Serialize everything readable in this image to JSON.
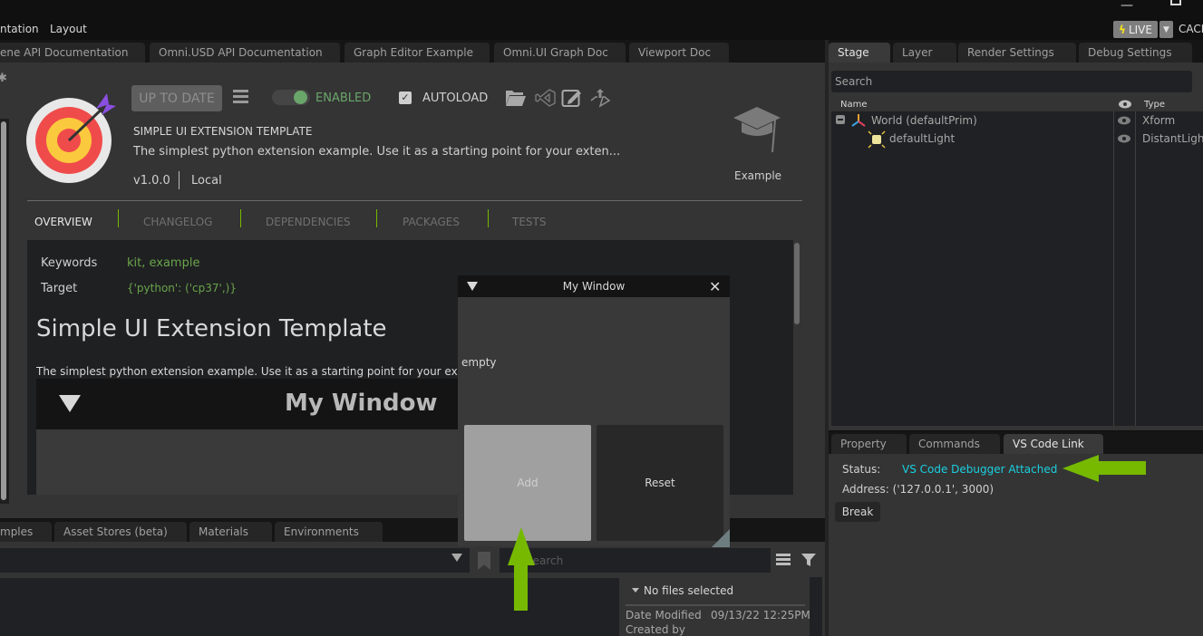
{
  "menubar": {
    "items": [
      "ntation",
      "Layout"
    ],
    "live_label": "LIVE",
    "cache_label": "CACH"
  },
  "doc_tabs": [
    {
      "label": "ene API Documentation"
    },
    {
      "label": "Omni.USD API Documentation"
    },
    {
      "label": "Graph Editor Example"
    },
    {
      "label": "Omni.UI Graph Doc"
    },
    {
      "label": "Viewport Doc"
    }
  ],
  "extension": {
    "status_button": "UP TO DATE",
    "enabled_label": "ENABLED",
    "enabled": true,
    "autoload_label": "AUTOLOAD",
    "autoload_checked": true,
    "title": "SIMPLE UI EXTENSION TEMPLATE",
    "description": "The simplest python extension example. Use it as a starting point for your exten...",
    "version": "v1.0.0",
    "source": "Local",
    "category": "Example",
    "accent_color": "#76b900",
    "subtabs": [
      "OVERVIEW",
      "CHANGELOG",
      "DEPENDENCIES",
      "PACKAGES",
      "TESTS"
    ],
    "active_subtab": "OVERVIEW",
    "overview": {
      "keywords_label": "Keywords",
      "keywords_value": "kit, example",
      "target_label": "Target",
      "target_value": "{'python': ('cp37',)}",
      "heading": "Simple UI Extension Template",
      "paragraph": "The simplest python extension example. Use it as a starting point for your extensions.",
      "image_title": "My Window"
    }
  },
  "my_window": {
    "title": "My Window",
    "label": "empty",
    "add_button": "Add",
    "reset_button": "Reset"
  },
  "content_browser": {
    "tabs": [
      "mples",
      "Asset Stores (beta)",
      "Materials",
      "Environments"
    ],
    "search_placeholder": "Search",
    "details": {
      "title": "No files selected",
      "date_modified_label": "Date Modified",
      "date_modified_value": "09/13/22 12:25PM",
      "created_by_label": "Created by"
    }
  },
  "stage": {
    "tabs": [
      "Stage",
      "Layer",
      "Render Settings",
      "Debug Settings"
    ],
    "active_tab": "Stage",
    "search_placeholder": "Search",
    "columns": {
      "name": "Name",
      "type": "Type"
    },
    "rows": [
      {
        "name": "World (defaultPrim)",
        "type": "Xform"
      },
      {
        "name": "defaultLight",
        "type": "DistantLight"
      }
    ]
  },
  "property": {
    "tabs": [
      "Property",
      "Commands",
      "VS Code Link"
    ],
    "active_tab": "VS Code Link",
    "status_label": "Status:",
    "status_value": "VS Code Debugger Attached",
    "status_color": "#19d0e0",
    "address_label": "Address: ('127.0.0.1', 3000)",
    "break_button": "Break"
  }
}
